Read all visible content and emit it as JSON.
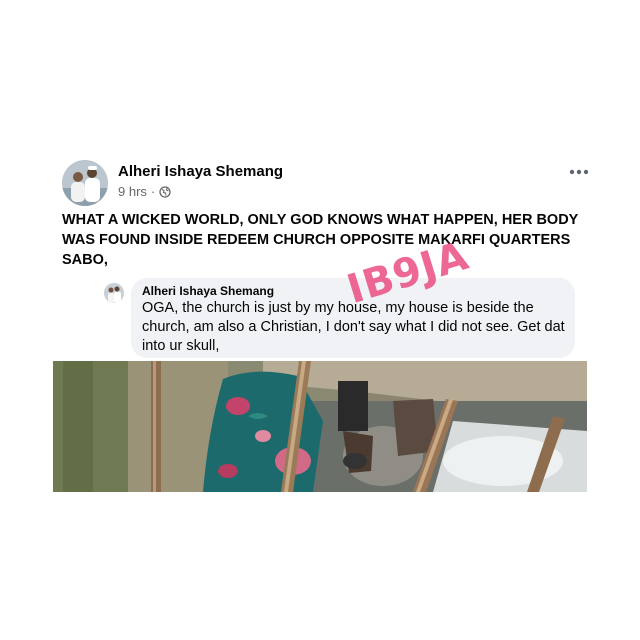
{
  "post": {
    "author": "Alheri Ishaya Shemang",
    "time": "9 hrs",
    "dot": "·",
    "text": "WHAT A WICKED WORLD, ONLY GOD KNOWS WHAT HAPPEN, HER BODY WAS FOUND INSIDE REDEEM CHURCH OPPOSITE MAKARFI QUARTERS SABO,",
    "more_label": "•••",
    "icons": {
      "audience": "globe-icon",
      "more": "more-options-icon"
    }
  },
  "comment": {
    "author": "Alheri Ishaya Shemang",
    "text": "OGA, the church is just by my house, my house is beside the church, am also a Christian, I don't say what I did not see. Get dat into ur skull,"
  },
  "watermark": {
    "text": "IB9JA",
    "color": "#e9477d"
  },
  "colors": {
    "bubble": "#f0f2f5",
    "meta": "#65676b",
    "text": "#050505"
  }
}
